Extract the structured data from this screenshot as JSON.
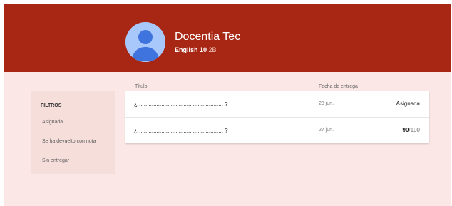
{
  "header": {
    "title": "Docentia Tec",
    "course": "English 10",
    "section": "2B",
    "avatar_icon": "account-circle-icon",
    "color": "#a82714"
  },
  "filters": {
    "title": "FILTROS",
    "items": [
      {
        "label": "Asignada"
      },
      {
        "label": "Se ha devuelto con nota"
      },
      {
        "label": "Sin entregar"
      }
    ]
  },
  "table": {
    "columns": {
      "title": "Título",
      "due": "Fecha de entrega"
    },
    "rows": [
      {
        "title": "¿ ..................................................... ?",
        "due": "28 jun.",
        "status": "Asignada"
      },
      {
        "title": "¿ ..................................................... ?",
        "due": "27 jun.",
        "grade": "90",
        "max": "/100"
      }
    ]
  }
}
